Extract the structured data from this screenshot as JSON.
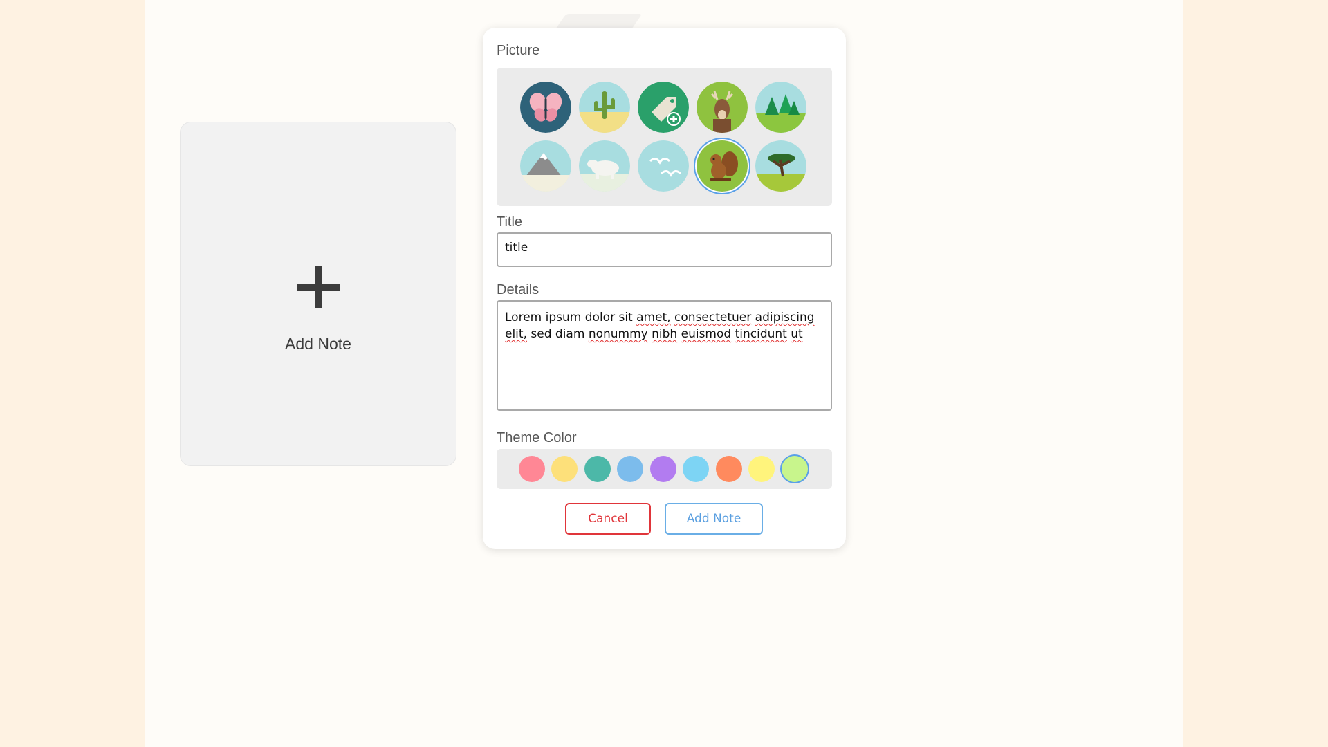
{
  "add_card": {
    "label": "Add Note",
    "icon": "plus-icon"
  },
  "modal": {
    "picture_label": "Picture",
    "pictures": [
      {
        "name": "butterfly",
        "selected": false
      },
      {
        "name": "cactus",
        "selected": false
      },
      {
        "name": "tag-add",
        "selected": false
      },
      {
        "name": "deer",
        "selected": false
      },
      {
        "name": "pine-trees",
        "selected": false
      },
      {
        "name": "mountain",
        "selected": false
      },
      {
        "name": "polar-bear",
        "selected": false
      },
      {
        "name": "seagulls",
        "selected": false
      },
      {
        "name": "squirrel",
        "selected": true
      },
      {
        "name": "acacia-tree",
        "selected": false
      }
    ],
    "title_label": "Title",
    "title_value": "title",
    "details_label": "Details",
    "details_value": "Lorem ipsum dolor sit amet, consectetuer adipiscing elit, sed diam nonummy nibh euismod tincidunt ut",
    "theme_label": "Theme Color",
    "theme_colors": [
      "#ff8795",
      "#fde07a",
      "#4cb8a8",
      "#7cbcec",
      "#b27cf0",
      "#7dd4f4",
      "#ff8a5e",
      "#fff47c",
      "#c8f58c"
    ],
    "selected_theme": "#c8f58c",
    "cancel_label": "Cancel",
    "submit_label": "Add Note"
  }
}
